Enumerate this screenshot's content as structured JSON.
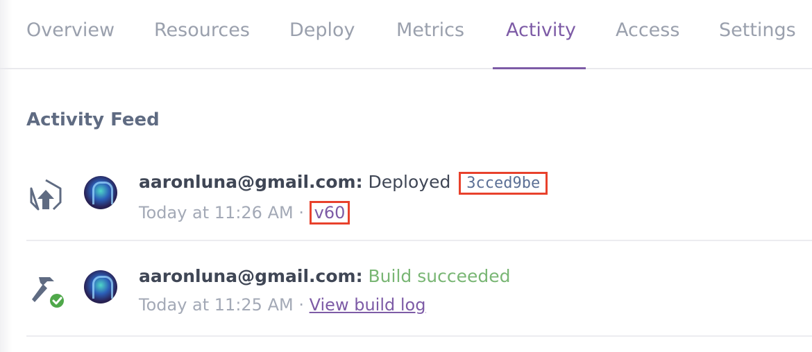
{
  "tabs": [
    {
      "label": "Overview",
      "active": false
    },
    {
      "label": "Resources",
      "active": false
    },
    {
      "label": "Deploy",
      "active": false
    },
    {
      "label": "Metrics",
      "active": false
    },
    {
      "label": "Activity",
      "active": true
    },
    {
      "label": "Access",
      "active": false
    },
    {
      "label": "Settings",
      "active": false
    }
  ],
  "section": {
    "title": "Activity Feed"
  },
  "feed": [
    {
      "icon": "deploy-upload-icon",
      "user": "aaronluna@gmail.com:",
      "action": "Deployed",
      "commit": "3cced9be",
      "time": "Today at 11:26 AM",
      "separator": "·",
      "version": "v60"
    },
    {
      "icon": "build-hammer-icon",
      "user": "aaronluna@gmail.com:",
      "action": "Build succeeded",
      "time": "Today at 11:25 AM",
      "separator": "·",
      "link": "View build log"
    }
  ],
  "colors": {
    "accent": "#7d5ba6",
    "success": "#79b674",
    "highlight_box": "#e8412c",
    "muted": "#a3a9b6"
  }
}
